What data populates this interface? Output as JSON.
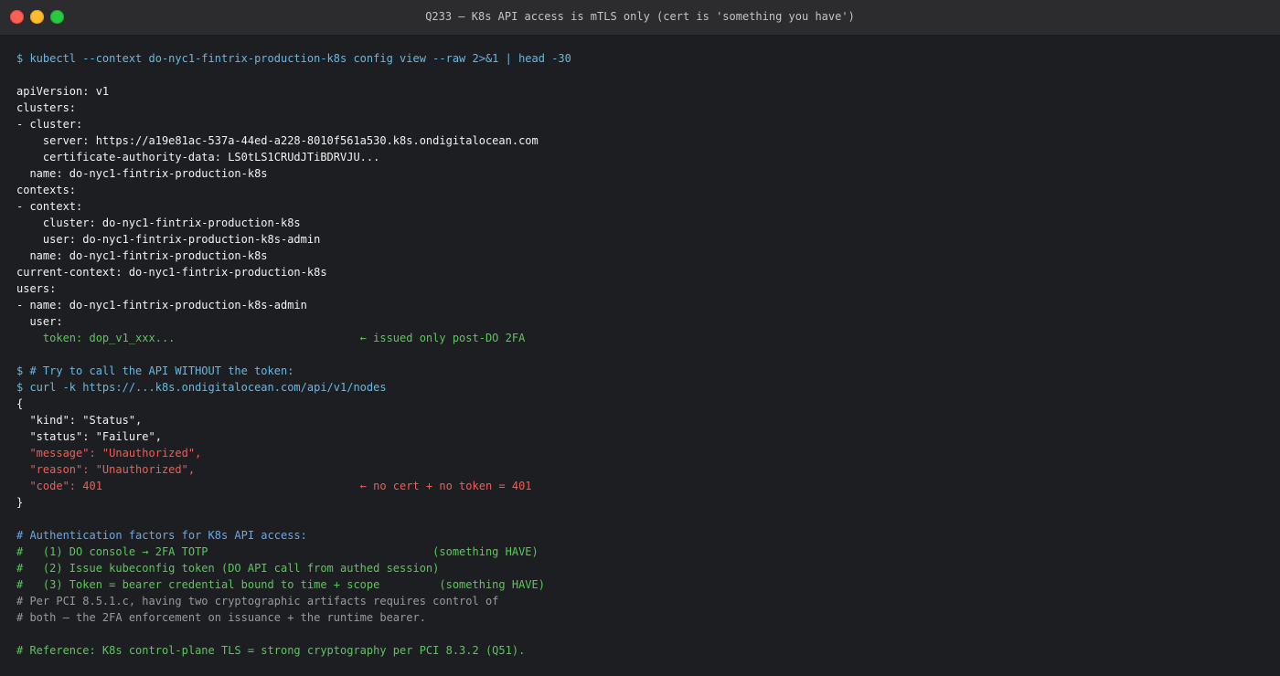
{
  "window": {
    "title": "Q233 — K8s API access is mTLS only (cert is 'something you have')"
  },
  "colors": {
    "background": "#1d1e21",
    "titlebar": "#2c2c2e",
    "command": "#64b9e6",
    "output": "#f2f2f2",
    "green": "#5ac85a",
    "red": "#f25c54",
    "comment_blue": "#6aa8e8",
    "comment_gray": "#9a9a9e"
  },
  "terminal": {
    "lines": [
      {
        "text": "$ kubectl --context do-nyc1-fintrix-production-k8s config view --raw 2>&1 | head -30",
        "kind": "cmd"
      },
      {
        "text": "",
        "kind": "out"
      },
      {
        "text": "apiVersion: v1",
        "kind": "out"
      },
      {
        "text": "clusters:",
        "kind": "out"
      },
      {
        "text": "- cluster:",
        "kind": "out"
      },
      {
        "text": "    server: https://a19e81ac-537a-44ed-a228-8010f561a530.k8s.ondigitalocean.com",
        "kind": "out"
      },
      {
        "text": "    certificate-authority-data: LS0tLS1CRUdJTiBDRVJU...",
        "kind": "out"
      },
      {
        "text": "  name: do-nyc1-fintrix-production-k8s",
        "kind": "out"
      },
      {
        "text": "contexts:",
        "kind": "out"
      },
      {
        "text": "- context:",
        "kind": "out"
      },
      {
        "text": "    cluster: do-nyc1-fintrix-production-k8s",
        "kind": "out"
      },
      {
        "text": "    user: do-nyc1-fintrix-production-k8s-admin",
        "kind": "out"
      },
      {
        "text": "  name: do-nyc1-fintrix-production-k8s",
        "kind": "out"
      },
      {
        "text": "current-context: do-nyc1-fintrix-production-k8s",
        "kind": "out"
      },
      {
        "text": "users:",
        "kind": "out"
      },
      {
        "text": "- name: do-nyc1-fintrix-production-k8s-admin",
        "kind": "out"
      },
      {
        "text": "  user:",
        "kind": "out"
      },
      {
        "text": "    token: dop_v1_xxx...                            ← issued only post-DO 2FA",
        "kind": "green"
      },
      {
        "text": "",
        "kind": "out"
      },
      {
        "text": "$ # Try to call the API WITHOUT the token:",
        "kind": "cmd"
      },
      {
        "text": "$ curl -k https://...k8s.ondigitalocean.com/api/v1/nodes",
        "kind": "cmd"
      },
      {
        "text": "{",
        "kind": "out"
      },
      {
        "text": "  \"kind\": \"Status\",",
        "kind": "out"
      },
      {
        "text": "  \"status\": \"Failure\",",
        "kind": "out"
      },
      {
        "text": "  \"message\": \"Unauthorized\",",
        "kind": "red"
      },
      {
        "text": "  \"reason\": \"Unauthorized\",",
        "kind": "red"
      },
      {
        "text": "  \"code\": 401                                       ← no cert + no token = 401",
        "kind": "red"
      },
      {
        "text": "}",
        "kind": "out"
      },
      {
        "text": "",
        "kind": "out"
      },
      {
        "text": "# Authentication factors for K8s API access:",
        "kind": "blue"
      },
      {
        "text": "#   (1) DO console → 2FA TOTP                                  (something HAVE)",
        "kind": "green"
      },
      {
        "text": "#   (2) Issue kubeconfig token (DO API call from authed session)",
        "kind": "green"
      },
      {
        "text": "#   (3) Token = bearer credential bound to time + scope         (something HAVE)",
        "kind": "green"
      },
      {
        "text": "# Per PCI 8.5.1.c, having two cryptographic artifacts requires control of",
        "kind": "gray"
      },
      {
        "text": "# both — the 2FA enforcement on issuance + the runtime bearer.",
        "kind": "gray"
      },
      {
        "text": "",
        "kind": "out"
      },
      {
        "text": "# Reference: K8s control-plane TLS = strong cryptography per PCI 8.3.2 (Q51).",
        "kind": "green"
      }
    ]
  }
}
